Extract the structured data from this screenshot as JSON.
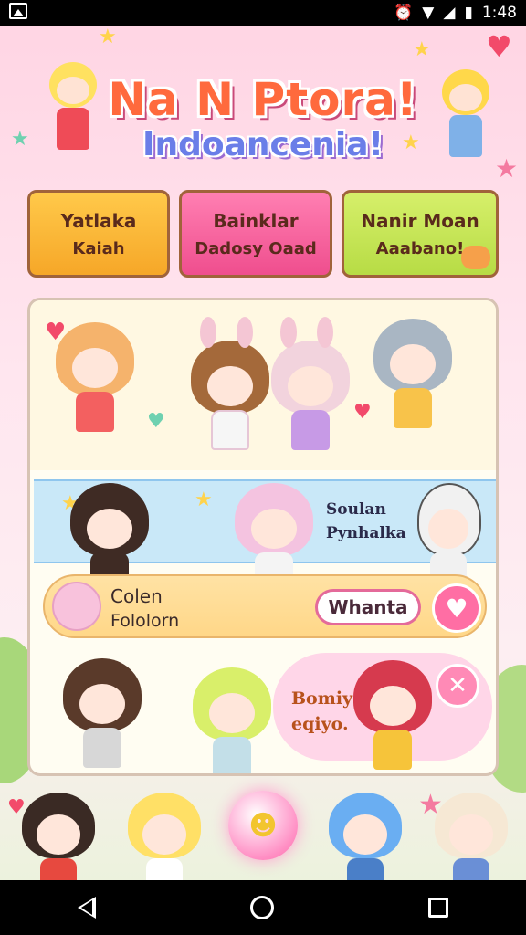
{
  "status_bar": {
    "time": "1:48",
    "icons": [
      "image-icon",
      "alarm-icon",
      "wifi-icon",
      "signal-icon",
      "battery-icon"
    ]
  },
  "header": {
    "title": "Na N Ptora!",
    "subtitle": "Indoancenia!"
  },
  "cards": [
    {
      "line1": "Yatlaka",
      "line2": "Kaiah"
    },
    {
      "line1": "Bainklar",
      "line2": "Dadosy Oaad"
    },
    {
      "line1": "Nanir Moan",
      "line2": "Aaabano!"
    }
  ],
  "panel": {
    "row2": {
      "label_line1": "Soulan",
      "label_line2": "Pynhalka"
    },
    "row3": {
      "title": "Colen",
      "subtitle": "Fololorn",
      "button_label": "Whanta"
    },
    "row4": {
      "bubble_line1": "Bomiy",
      "bubble_line2": "eqiyo."
    }
  },
  "colors": {
    "accent_pink": "#ff6ea4",
    "title_orange": "#ff6a3d",
    "subtitle_blue": "#6a7ee8"
  }
}
